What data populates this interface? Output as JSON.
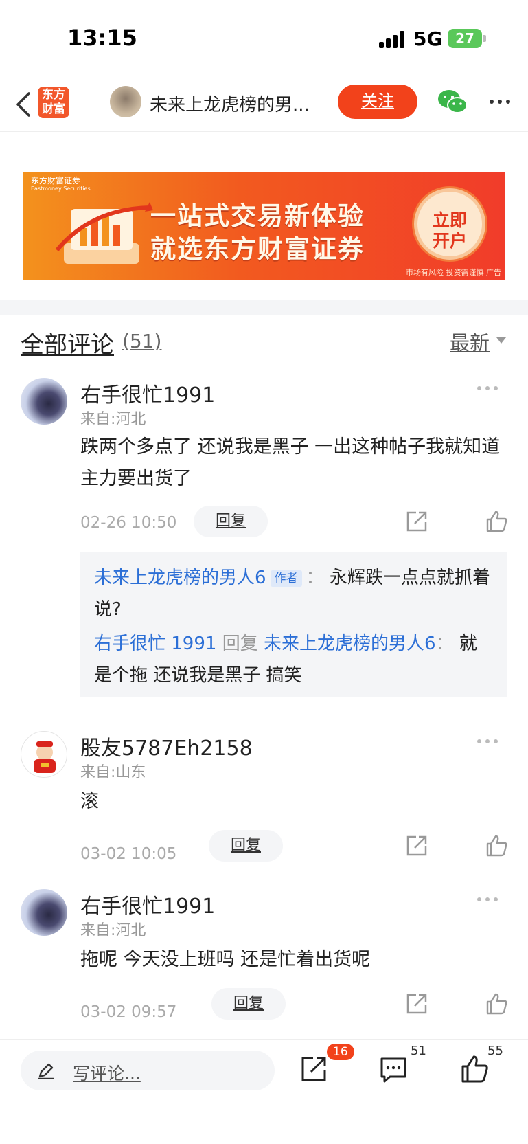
{
  "status_bar": {
    "time": "13:15",
    "network": "5G",
    "battery": "27"
  },
  "nav": {
    "logo_line1": "东方",
    "logo_line2": "财富",
    "title": "未来上龙虎榜的男...",
    "follow_label": "关注"
  },
  "ad": {
    "brand": "东方财富证券",
    "brand_en": "Eastmoney Securities",
    "line1": "一站式交易新体验",
    "line2": "就选东方财富证券",
    "button_line1": "立即",
    "button_line2": "开户",
    "disclaimer": "市场有风险 投资需谨慎 广告"
  },
  "comments_header": {
    "title": "全部评论",
    "count": "(51)",
    "sort": "最新"
  },
  "comments": [
    {
      "author": "右手很忙1991",
      "location": "来自:河北",
      "text": "跌两个多点了  还说我是黑子  一出这种帖子我就知道 主力要出货了",
      "date": "02-26 10:50",
      "reply_label": "回复",
      "replies": [
        {
          "from": "未来上龙虎榜的男人6",
          "tag": "作者",
          "sep": "：",
          "text": "永辉跌一点点就抓着说?"
        },
        {
          "from": "右手很忙 1991",
          "reply_word": "回复",
          "to": "未来上龙虎榜的男人6",
          "sep": "：",
          "text": "就是个拖 还说我是黑子  搞笑"
        }
      ]
    },
    {
      "author": "股友5787Eh2158",
      "location": "来自:山东",
      "text": "滚",
      "date": "03-02 10:05",
      "reply_label": "回复"
    },
    {
      "author": "右手很忙1991",
      "location": "来自:河北",
      "text": "拖呢  今天没上班吗 还是忙着出货呢",
      "date": "03-02 09:57",
      "reply_label": "回复"
    }
  ],
  "bottom_bar": {
    "input_placeholder": "写评论...",
    "share_count": "16",
    "comment_count": "51",
    "like_count": "55"
  },
  "colors": {
    "accent": "#f2421b",
    "link": "#2c6fd6"
  }
}
